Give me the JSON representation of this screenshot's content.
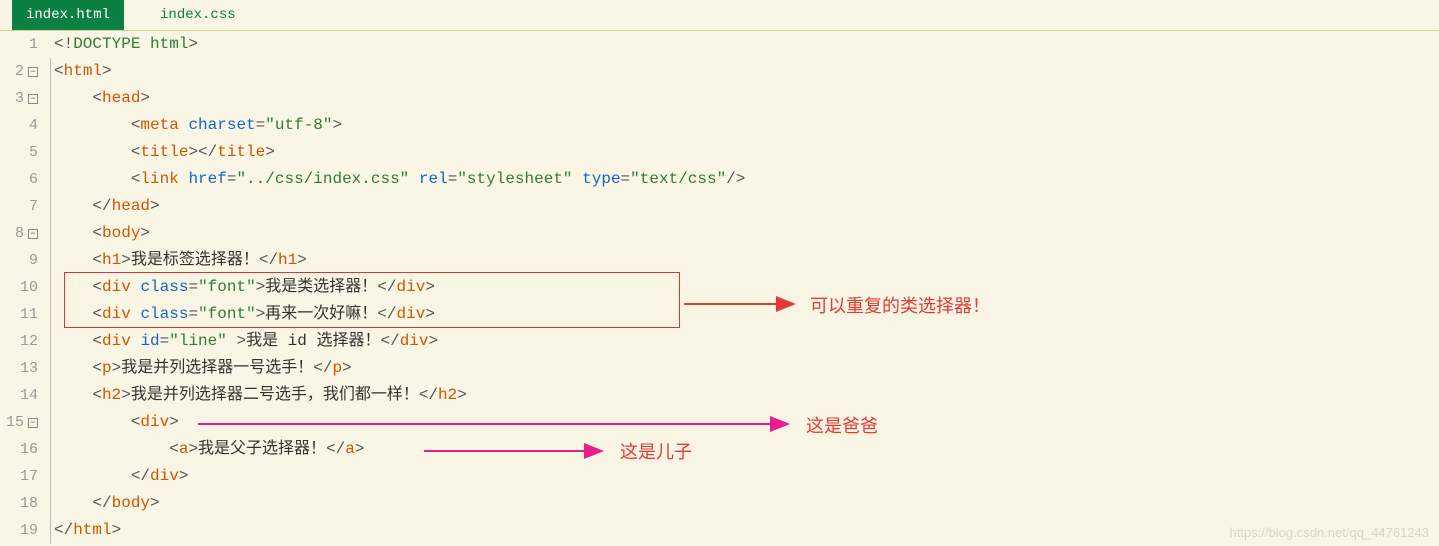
{
  "tabs": {
    "active": "index.html",
    "inactive": "index.css"
  },
  "lines": [
    {
      "n": "1",
      "indent": "",
      "tokens": [
        [
          "punct",
          "<!"
        ],
        [
          "doctype",
          "DOCTYPE html"
        ],
        [
          "punct",
          ">"
        ]
      ]
    },
    {
      "n": "2",
      "fold": true,
      "indent": "",
      "tokens": [
        [
          "punct",
          "<"
        ],
        [
          "tagn",
          "html"
        ],
        [
          "punct",
          ">"
        ]
      ]
    },
    {
      "n": "3",
      "fold": true,
      "indent": "    ",
      "tokens": [
        [
          "punct",
          "<"
        ],
        [
          "tagn",
          "head"
        ],
        [
          "punct",
          ">"
        ]
      ]
    },
    {
      "n": "4",
      "indent": "        ",
      "tokens": [
        [
          "punct",
          "<"
        ],
        [
          "tagn",
          "meta"
        ],
        [
          "txt",
          " "
        ],
        [
          "attr",
          "charset"
        ],
        [
          "punct",
          "="
        ],
        [
          "str",
          "\"utf-8\""
        ],
        [
          "punct",
          ">"
        ]
      ]
    },
    {
      "n": "5",
      "indent": "        ",
      "tokens": [
        [
          "punct",
          "<"
        ],
        [
          "tagn",
          "title"
        ],
        [
          "punct",
          "></"
        ],
        [
          "tagn",
          "title"
        ],
        [
          "punct",
          ">"
        ]
      ]
    },
    {
      "n": "6",
      "indent": "        ",
      "tokens": [
        [
          "punct",
          "<"
        ],
        [
          "tagn",
          "link"
        ],
        [
          "txt",
          " "
        ],
        [
          "attr",
          "href"
        ],
        [
          "punct",
          "="
        ],
        [
          "str",
          "\"../css/index.css\""
        ],
        [
          "txt",
          " "
        ],
        [
          "attr",
          "rel"
        ],
        [
          "punct",
          "="
        ],
        [
          "str",
          "\"stylesheet\""
        ],
        [
          "txt",
          " "
        ],
        [
          "attr",
          "type"
        ],
        [
          "punct",
          "="
        ],
        [
          "str",
          "\"text/css\""
        ],
        [
          "punct",
          "/>"
        ]
      ]
    },
    {
      "n": "7",
      "indent": "    ",
      "tokens": [
        [
          "punct",
          "</"
        ],
        [
          "tagn",
          "head"
        ],
        [
          "punct",
          ">"
        ]
      ]
    },
    {
      "n": "8",
      "fold": true,
      "indent": "    ",
      "tokens": [
        [
          "punct",
          "<"
        ],
        [
          "tagn",
          "body"
        ],
        [
          "punct",
          ">"
        ]
      ]
    },
    {
      "n": "9",
      "indent": "    ",
      "tokens": [
        [
          "punct",
          "<"
        ],
        [
          "tagn",
          "h1"
        ],
        [
          "punct",
          ">"
        ],
        [
          "txt",
          "我是标签选择器！"
        ],
        [
          "punct",
          "</"
        ],
        [
          "tagn",
          "h1"
        ],
        [
          "punct",
          ">"
        ]
      ]
    },
    {
      "n": "10",
      "indent": "    ",
      "tokens": [
        [
          "punct",
          "<"
        ],
        [
          "tagn",
          "div"
        ],
        [
          "txt",
          " "
        ],
        [
          "attr",
          "class"
        ],
        [
          "punct",
          "="
        ],
        [
          "str",
          "\"font\""
        ],
        [
          "punct",
          ">"
        ],
        [
          "txt",
          "我是类选择器！"
        ],
        [
          "punct",
          "</"
        ],
        [
          "tagn",
          "div"
        ],
        [
          "punct",
          ">"
        ]
      ]
    },
    {
      "n": "11",
      "indent": "    ",
      "tokens": [
        [
          "punct",
          "<"
        ],
        [
          "tagn",
          "div"
        ],
        [
          "txt",
          " "
        ],
        [
          "attr",
          "class"
        ],
        [
          "punct",
          "="
        ],
        [
          "str",
          "\"font\""
        ],
        [
          "punct",
          ">"
        ],
        [
          "txt",
          "再来一次好嘛！"
        ],
        [
          "punct",
          "</"
        ],
        [
          "tagn",
          "div"
        ],
        [
          "punct",
          ">"
        ]
      ]
    },
    {
      "n": "12",
      "indent": "    ",
      "tokens": [
        [
          "punct",
          "<"
        ],
        [
          "tagn",
          "div"
        ],
        [
          "txt",
          " "
        ],
        [
          "attr",
          "id"
        ],
        [
          "punct",
          "="
        ],
        [
          "str",
          "\"line\""
        ],
        [
          "txt",
          " "
        ],
        [
          "punct",
          ">"
        ],
        [
          "txt",
          "我是 id 选择器！"
        ],
        [
          "punct",
          "</"
        ],
        [
          "tagn",
          "div"
        ],
        [
          "punct",
          ">"
        ]
      ]
    },
    {
      "n": "13",
      "indent": "    ",
      "tokens": [
        [
          "punct",
          "<"
        ],
        [
          "tagn",
          "p"
        ],
        [
          "punct",
          ">"
        ],
        [
          "txt",
          "我是并列选择器一号选手！"
        ],
        [
          "punct",
          "</"
        ],
        [
          "tagn",
          "p"
        ],
        [
          "punct",
          ">"
        ]
      ]
    },
    {
      "n": "14",
      "indent": "    ",
      "tokens": [
        [
          "punct",
          "<"
        ],
        [
          "tagn",
          "h2"
        ],
        [
          "punct",
          ">"
        ],
        [
          "txt",
          "我是并列选择器二号选手，我们都一样！"
        ],
        [
          "punct",
          "</"
        ],
        [
          "tagn",
          "h2"
        ],
        [
          "punct",
          ">"
        ]
      ]
    },
    {
      "n": "15",
      "fold": true,
      "indent": "        ",
      "tokens": [
        [
          "punct",
          "<"
        ],
        [
          "tagn",
          "div"
        ],
        [
          "punct",
          ">"
        ]
      ]
    },
    {
      "n": "16",
      "indent": "            ",
      "tokens": [
        [
          "punct",
          "<"
        ],
        [
          "tagn",
          "a"
        ],
        [
          "punct",
          ">"
        ],
        [
          "txt",
          "我是父子选择器！"
        ],
        [
          "punct",
          "</"
        ],
        [
          "tagn",
          "a"
        ],
        [
          "punct",
          ">"
        ]
      ]
    },
    {
      "n": "17",
      "indent": "        ",
      "tokens": [
        [
          "punct",
          "</"
        ],
        [
          "tagn",
          "div"
        ],
        [
          "punct",
          ">"
        ]
      ]
    },
    {
      "n": "18",
      "indent": "    ",
      "tokens": [
        [
          "punct",
          "</"
        ],
        [
          "tagn",
          "body"
        ],
        [
          "punct",
          ">"
        ]
      ]
    },
    {
      "n": "19",
      "indent": "",
      "tokens": [
        [
          "punct",
          "</"
        ],
        [
          "tagn",
          "html"
        ],
        [
          "punct",
          ">"
        ]
      ]
    }
  ],
  "annotations": {
    "redbox_label": "可以重复的类选择器！",
    "parent_label": "这是爸爸",
    "child_label": "这是儿子"
  },
  "watermark": "https://blog.csdn.net/qq_44761243"
}
